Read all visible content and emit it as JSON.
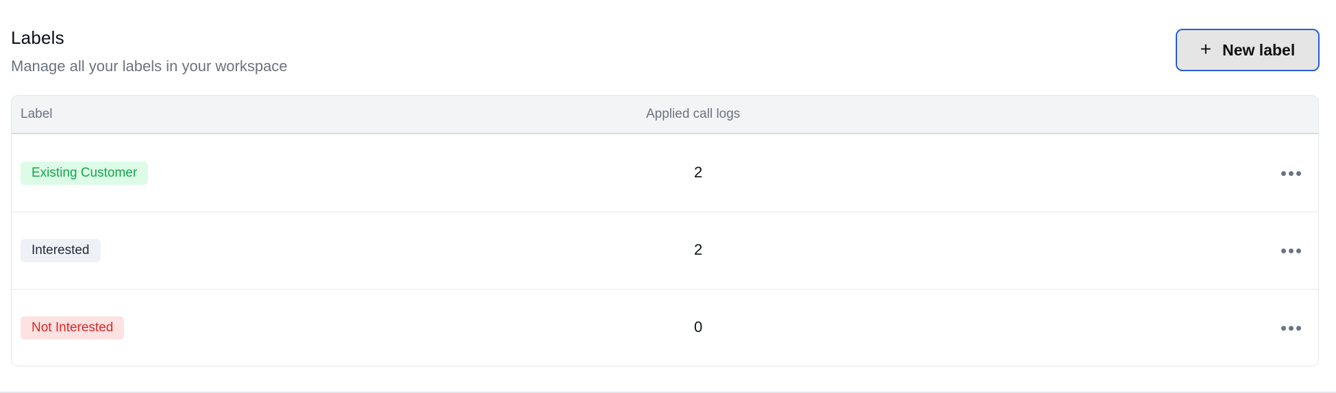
{
  "header": {
    "title": "Labels",
    "subtitle": "Manage all your labels in your workspace",
    "new_label_button": "New label"
  },
  "table": {
    "columns": [
      "Label",
      "Applied call logs"
    ],
    "rows": [
      {
        "label": "Existing Customer",
        "count": "2",
        "chip_bg": "#dcfce7",
        "chip_fg": "#16a34a"
      },
      {
        "label": "Interested",
        "count": "2",
        "chip_bg": "#eef2f7",
        "chip_fg": "#1f2937"
      },
      {
        "label": "Not Interested",
        "count": "0",
        "chip_bg": "#fde2e2",
        "chip_fg": "#dc2626"
      }
    ]
  },
  "icons": {
    "new_label": "plus-icon",
    "row_actions": "more-horizontal-icon"
  },
  "colors": {
    "button_border": "#2a5bd7",
    "button_bg": "#e5e5e5",
    "header_bg": "#f3f4f6",
    "muted_text": "#6b7280"
  }
}
